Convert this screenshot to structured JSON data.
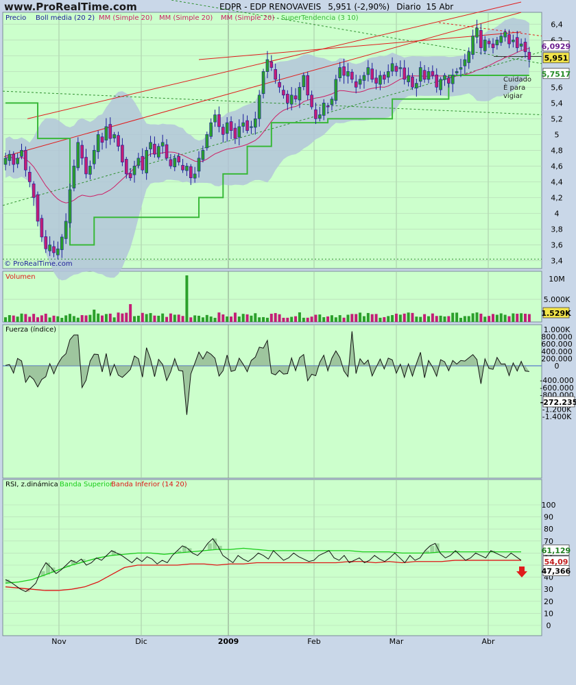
{
  "header": {
    "site": "www.ProRealTime.com",
    "symbol": "EDPR - EDP RENOVAVEIS",
    "last": "5,951 (-2,90%)",
    "period": "Diario  15 Abr"
  },
  "colors": {
    "bg": "#ccffcc",
    "band": "#b3c6d9",
    "candle_up": "#2ba02b",
    "candle_down": "#c21e76",
    "outline": "#1a1a99",
    "supertrend": "#38b838",
    "trend": "#e01b1b",
    "mm20": "#cc1f66",
    "zero": "#3855cc",
    "rsi_sup": "#18cc18",
    "rsi_inf": "#dd1515"
  },
  "chart_data": [
    {
      "panel": "price",
      "type": "candlestick",
      "legend": [
        "Precio",
        "Boll media (20 2)",
        "MM (Simple 20)",
        "MM (Simple 20)",
        "MM (Simple 20)",
        "SuperTendencia (3 10)"
      ],
      "ylim": [
        3.3,
        6.55
      ],
      "yticks": [
        "6,4",
        "6,2",
        "6",
        "5,8",
        "5,6",
        "5,4",
        "5,2",
        "5",
        "4,8",
        "4,6",
        "4,4",
        "4,2",
        "4",
        "3,8",
        "3,6",
        "3,4"
      ],
      "x_labels": [
        "Nov",
        "Dic",
        "2009",
        "Feb",
        "Mar",
        "Abr"
      ],
      "last_labels": {
        "upper": "6,0929",
        "price": "5,951",
        "lower": "5,7517"
      },
      "annotation": [
        "Cuidado",
        "È  para",
        "vigiar"
      ],
      "close": [
        4.7,
        4.75,
        4.62,
        4.7,
        4.8,
        4.55,
        4.4,
        4.2,
        3.9,
        3.7,
        3.55,
        3.6,
        3.5,
        3.55,
        3.7,
        3.9,
        4.3,
        4.6,
        4.9,
        4.7,
        4.5,
        4.6,
        4.8,
        5.0,
        4.9,
        5.1,
        4.95,
        5.0,
        4.85,
        4.65,
        4.5,
        4.45,
        4.6,
        4.7,
        4.55,
        4.8,
        4.9,
        4.75,
        4.85,
        4.9,
        4.7,
        4.6,
        4.7,
        4.65,
        4.55,
        4.6,
        4.45,
        4.5,
        4.7,
        4.8,
        5.0,
        5.15,
        5.25,
        5.1,
        5.0,
        5.15,
        5.05,
        4.95,
        5.1,
        5.15,
        5.05,
        5.1,
        5.2,
        5.5,
        5.8,
        5.95,
        5.85,
        5.7,
        5.6,
        5.5,
        5.4,
        5.5,
        5.45,
        5.6,
        5.75,
        5.5,
        5.35,
        5.2,
        5.25,
        5.4,
        5.35,
        5.45,
        5.7,
        5.85,
        5.75,
        5.8,
        5.7,
        5.6,
        5.7,
        5.75,
        5.85,
        5.7,
        5.65,
        5.75,
        5.7,
        5.8,
        5.9,
        5.8,
        5.85,
        5.7,
        5.75,
        5.6,
        5.65,
        5.85,
        5.7,
        5.8,
        5.75,
        5.6,
        5.7,
        5.75,
        5.65,
        5.75,
        5.8,
        5.85,
        5.95,
        6.05,
        6.25,
        6.35,
        6.1,
        6.2,
        6.15,
        6.1,
        6.2,
        6.25,
        6.3,
        6.15,
        6.2,
        6.1,
        6.15,
        6.05,
        5.95
      ]
    },
    {
      "panel": "volume",
      "type": "bar",
      "label": "Volumen",
      "yticks": [
        "10M",
        "5.000K"
      ],
      "last_label": "1.529K"
    },
    {
      "panel": "fuerza",
      "type": "area",
      "label": "Fuerza (índice)",
      "yticks": [
        "1.000K",
        "800.000",
        "600.000",
        "400.000",
        "200.000",
        "0",
        "-400.000",
        "-600.000",
        "-800.000",
        "-1.000K",
        "-1.200K",
        "-1.400K"
      ],
      "last_label": "-272.235"
    },
    {
      "panel": "rsi",
      "type": "line",
      "label": "RSI, z.dinámica",
      "legend": [
        "Banda Superior",
        "Banda Inferior (14 20)"
      ],
      "yticks": [
        "100",
        "90",
        "80",
        "70",
        "60",
        "50",
        "40",
        "30",
        "20",
        "10",
        "0"
      ],
      "ylim": [
        -5,
        105
      ],
      "last_labels": {
        "sup": "61,129",
        "inf": "54,09",
        "rsi": "47,366"
      },
      "rsi": [
        38,
        36,
        33,
        30,
        28,
        31,
        35,
        45,
        52,
        48,
        43,
        46,
        50,
        54,
        52,
        55,
        50,
        52,
        56,
        54,
        58,
        62,
        60,
        58,
        55,
        52,
        56,
        53,
        57,
        55,
        51,
        54,
        52,
        58,
        62,
        66,
        64,
        60,
        58,
        62,
        68,
        72,
        66,
        58,
        55,
        52,
        58,
        55,
        53,
        56,
        60,
        58,
        55,
        62,
        58,
        54,
        56,
        60,
        57,
        55,
        53,
        54,
        58,
        60,
        62,
        56,
        54,
        58,
        52,
        54,
        56,
        52,
        54,
        58,
        55,
        53,
        56,
        60,
        56,
        52,
        58,
        54,
        56,
        62,
        66,
        68,
        60,
        56,
        58,
        62,
        58,
        54,
        56,
        60,
        58,
        56,
        62,
        60,
        58,
        56,
        60,
        57,
        54
      ],
      "band_sup": [
        35,
        36,
        38,
        42,
        46,
        50,
        53,
        56,
        58,
        59,
        60,
        60,
        59,
        60,
        61,
        62,
        63,
        63,
        64,
        63,
        62,
        62,
        62,
        62,
        62,
        62,
        62,
        61,
        61,
        61,
        60,
        60,
        60,
        61,
        61,
        61,
        61,
        61,
        61,
        61
      ],
      "band_inf": [
        32,
        31,
        30,
        29,
        29,
        30,
        32,
        36,
        42,
        48,
        50,
        50,
        50,
        50,
        51,
        51,
        50,
        51,
        51,
        52,
        52,
        52,
        52,
        52,
        52,
        52,
        53,
        53,
        52,
        53,
        52,
        53,
        53,
        53,
        54,
        54,
        54,
        54,
        54,
        54
      ]
    }
  ]
}
